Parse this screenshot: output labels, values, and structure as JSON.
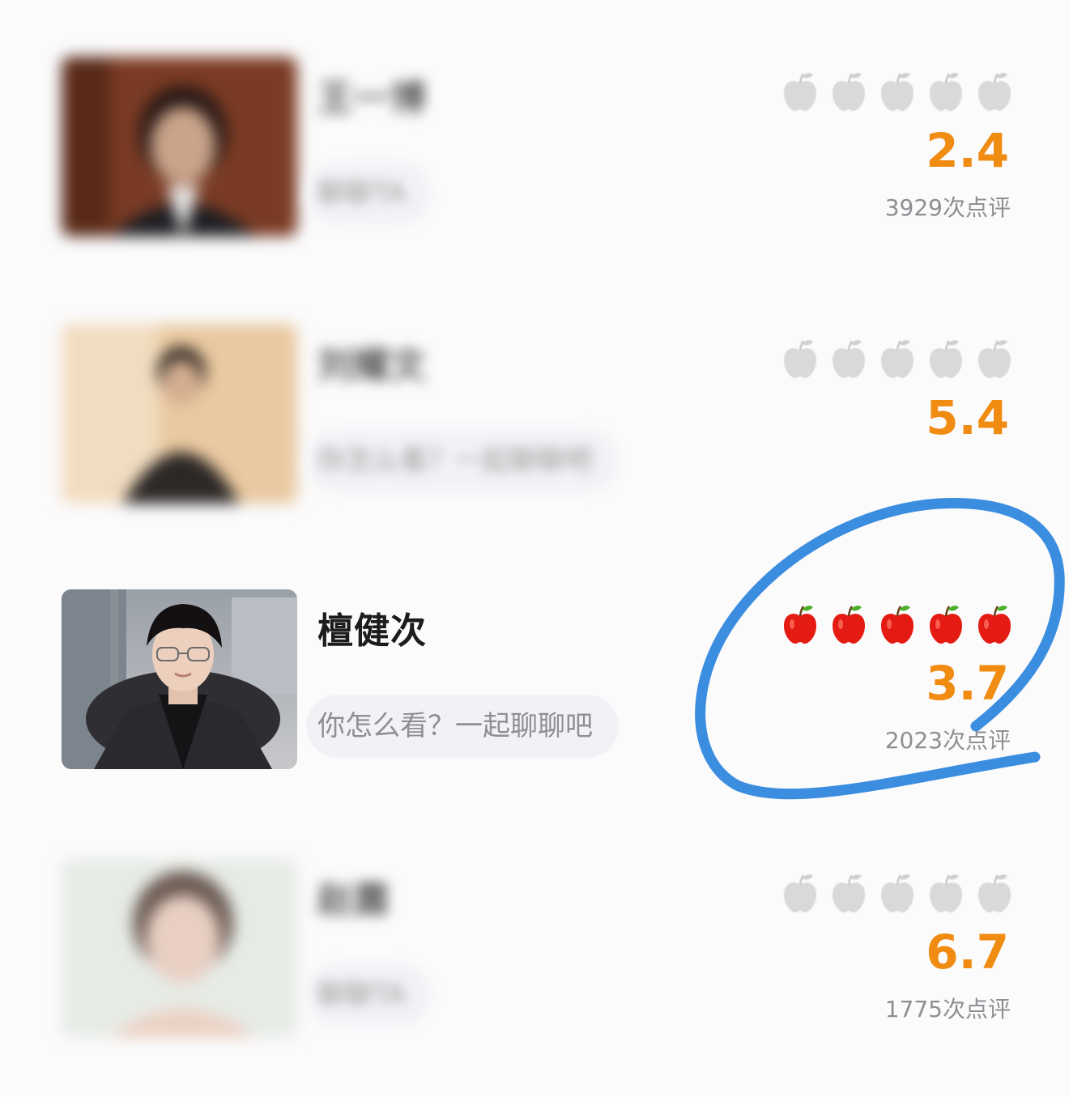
{
  "theme": {
    "score_color": "#f08c12",
    "apple_empty_color": "#d9d9d9",
    "apple_filled_color": "#e41b13",
    "annotation_color": "#3b8de0"
  },
  "items": [
    {
      "name": "王一博",
      "name_blurred": true,
      "chat_label": "聊聊TA",
      "chat_blurred": true,
      "apples_filled": 0,
      "score": "2.4",
      "reviews": "3929次点评",
      "reviews_blurred": false
    },
    {
      "name": "刘耀文",
      "name_blurred": true,
      "chat_label": "你怎么看？一起聊聊吧",
      "chat_blurred": true,
      "apples_filled": 0,
      "score": "5.4",
      "reviews": "",
      "reviews_blurred": true
    },
    {
      "name": "檀健次",
      "name_blurred": false,
      "chat_label": "你怎么看？一起聊聊吧",
      "chat_blurred": false,
      "apples_filled": 5,
      "score": "3.7",
      "reviews": "2023次点评",
      "reviews_blurred": false
    },
    {
      "name": "赵露",
      "name_blurred": true,
      "chat_label": "聊聊TA",
      "chat_blurred": true,
      "apples_filled": 0,
      "score": "6.7",
      "reviews": "1775次点评",
      "reviews_blurred": false
    }
  ]
}
